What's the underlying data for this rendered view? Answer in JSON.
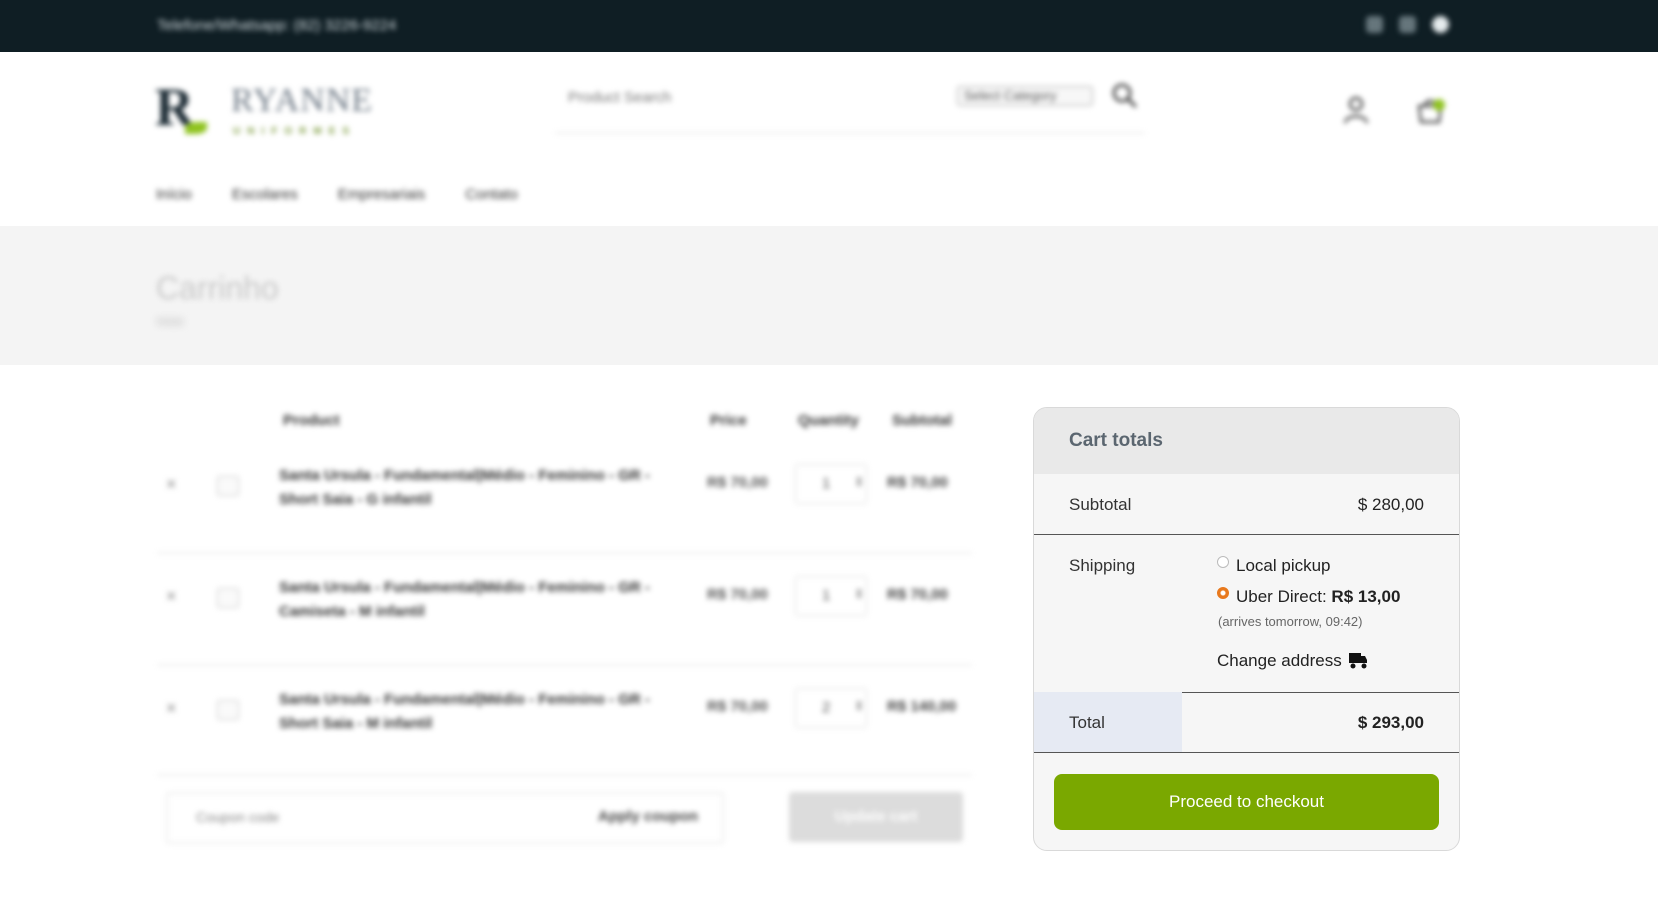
{
  "topbar": {
    "phone": "Telefone/Whatsapp: (82) 3226-9224",
    "social_icons": [
      "facebook-icon",
      "instagram-icon",
      "whatsapp-icon"
    ]
  },
  "header": {
    "logo_mark": "R",
    "logo_word": "RYANNE",
    "logo_sub": "UNIFORMES",
    "search_placeholder": "Product Search",
    "category_select": "Select Category",
    "icons": [
      "search-icon",
      "user-icon",
      "cart-icon"
    ]
  },
  "nav": {
    "items": [
      "Início",
      "Escolares",
      "Empresariais",
      "Contato"
    ]
  },
  "band": {
    "title": "Carrinho",
    "breadcrumb": "Início"
  },
  "cart": {
    "columns": [
      "Product",
      "Price",
      "Quantity",
      "Subtotal"
    ],
    "rows": [
      {
        "name": "Santa Ursula - Fundamental|Médio - Feminino - GR - Short Saia - G infantil",
        "price": "R$ 70,00",
        "qty": "1",
        "subtotal": "R$ 70,00"
      },
      {
        "name": "Santa Ursula - Fundamental|Médio - Feminino - GR - Camiseta - M infantil",
        "price": "R$ 70,00",
        "qty": "1",
        "subtotal": "R$ 70,00"
      },
      {
        "name": "Santa Ursula - Fundamental|Médio - Feminino - GR - Short Saia - M infantil",
        "price": "R$ 70,00",
        "qty": "2",
        "subtotal": "R$ 140,00"
      }
    ],
    "coupon_placeholder": "Coupon code",
    "apply_coupon": "Apply coupon",
    "update_cart": "Update cart"
  },
  "totals": {
    "title": "Cart totals",
    "subtotal_label": "Subtotal",
    "subtotal_value": "$ 280,00",
    "shipping_label": "Shipping",
    "option_local": "Local pickup",
    "option_uber_label": "Uber Direct: ",
    "option_uber_price": "R$ 13,00",
    "arrival_note": "(arrives tomorrow, 09:42)",
    "change_address": "Change address",
    "total_label": "Total",
    "total_value": "$ 293,00",
    "checkout_button": "Proceed to checkout",
    "accent_color": "#7aa800",
    "radio_selected_color": "#e8791d"
  }
}
